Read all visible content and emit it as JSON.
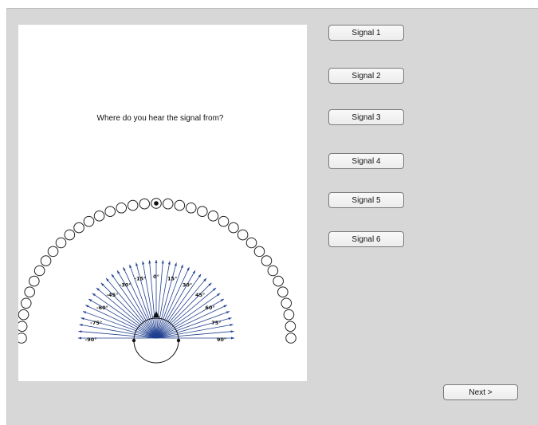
{
  "question": "Where do you hear the signal from?",
  "signal_buttons": [
    {
      "label": "Signal 1"
    },
    {
      "label": "Signal 2"
    },
    {
      "label": "Signal 3"
    },
    {
      "label": "Signal 4"
    },
    {
      "label": "Signal 5"
    },
    {
      "label": "Signal 6"
    }
  ],
  "next_label": "Next >",
  "selector": {
    "ring_count": 37,
    "selected_index": 18,
    "angle_labels": [
      "-90°",
      "-75°",
      "-60°",
      "-45°",
      "-30°",
      "-15°",
      "0°",
      "15°",
      "30°",
      "45°",
      "60°",
      "75°",
      "90°"
    ]
  },
  "colors": {
    "background": "#d7d7d7",
    "panel": "#ffffff",
    "ray": "#1f3f8f",
    "button_border": "#7b7b7b"
  }
}
